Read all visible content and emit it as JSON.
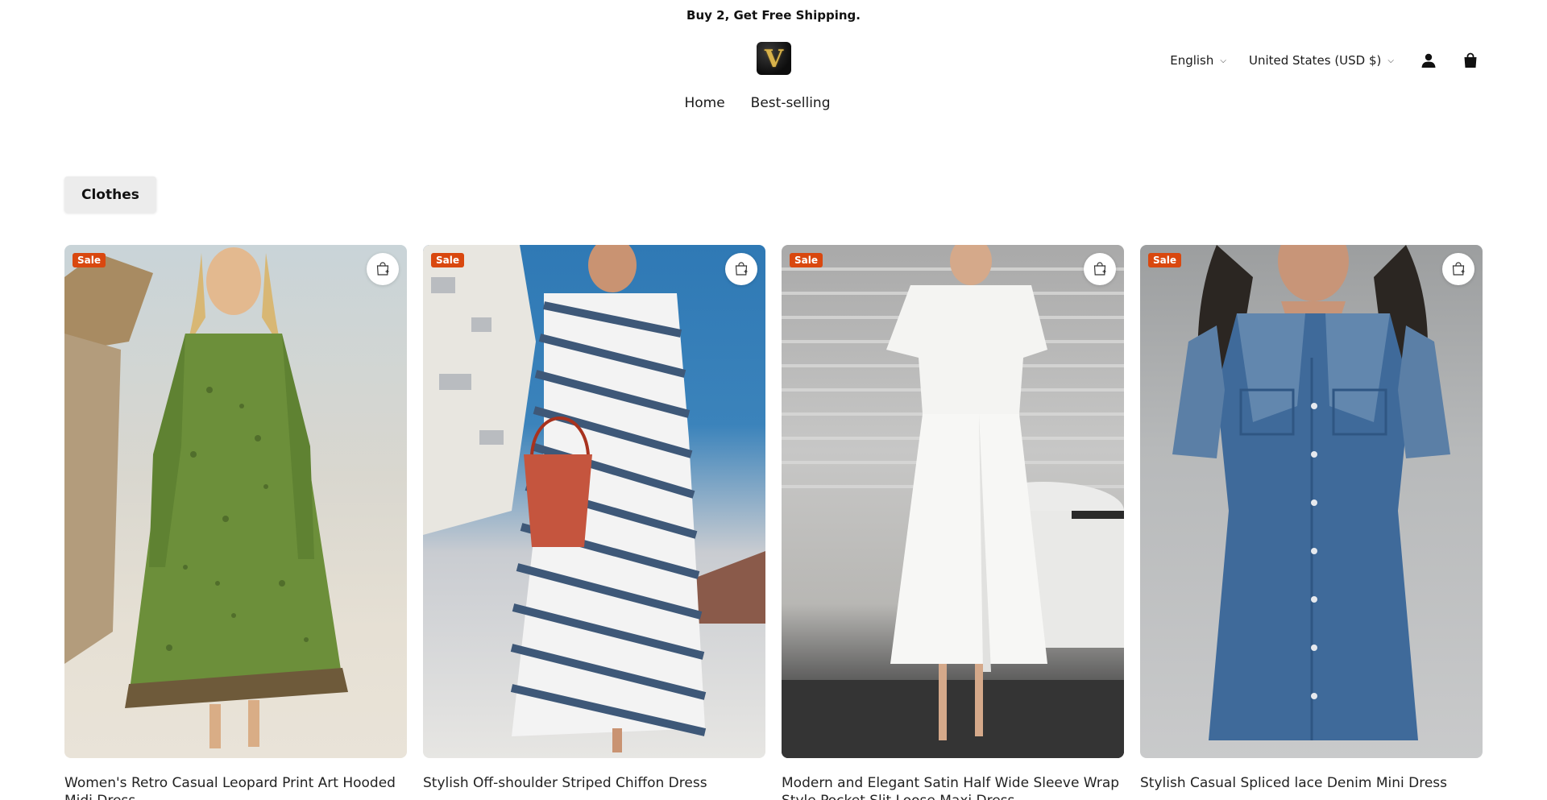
{
  "announcement": {
    "text": "Buy 2, Get Free Shipping."
  },
  "header": {
    "logo_letter": "V",
    "language": "English",
    "currency": "United States (USD $)",
    "account_icon": "person-icon",
    "cart_icon": "shopping-bag-icon"
  },
  "nav": {
    "items": [
      {
        "label": "Home"
      },
      {
        "label": "Best-selling"
      }
    ]
  },
  "filters": {
    "active": "Clothes"
  },
  "products": [
    {
      "badge": "Sale",
      "title": "Women's Retro Casual Leopard Print Art Hooded Midi Dress",
      "quick_add_icon": "shopping-bag-plus-icon"
    },
    {
      "badge": "Sale",
      "title": "Stylish Off-shoulder Striped Chiffon Dress",
      "quick_add_icon": "shopping-bag-plus-icon"
    },
    {
      "badge": "Sale",
      "title": "Modern and Elegant Satin Half Wide Sleeve Wrap Style Pocket Slit Loose Maxi Dress",
      "quick_add_icon": "shopping-bag-plus-icon"
    },
    {
      "badge": "Sale",
      "title": "Stylish Casual Spliced lace Denim Mini Dress",
      "quick_add_icon": "shopping-bag-plus-icon"
    }
  ],
  "colors": {
    "sale_badge": "#d9480f",
    "chip_bg": "#ececec"
  }
}
